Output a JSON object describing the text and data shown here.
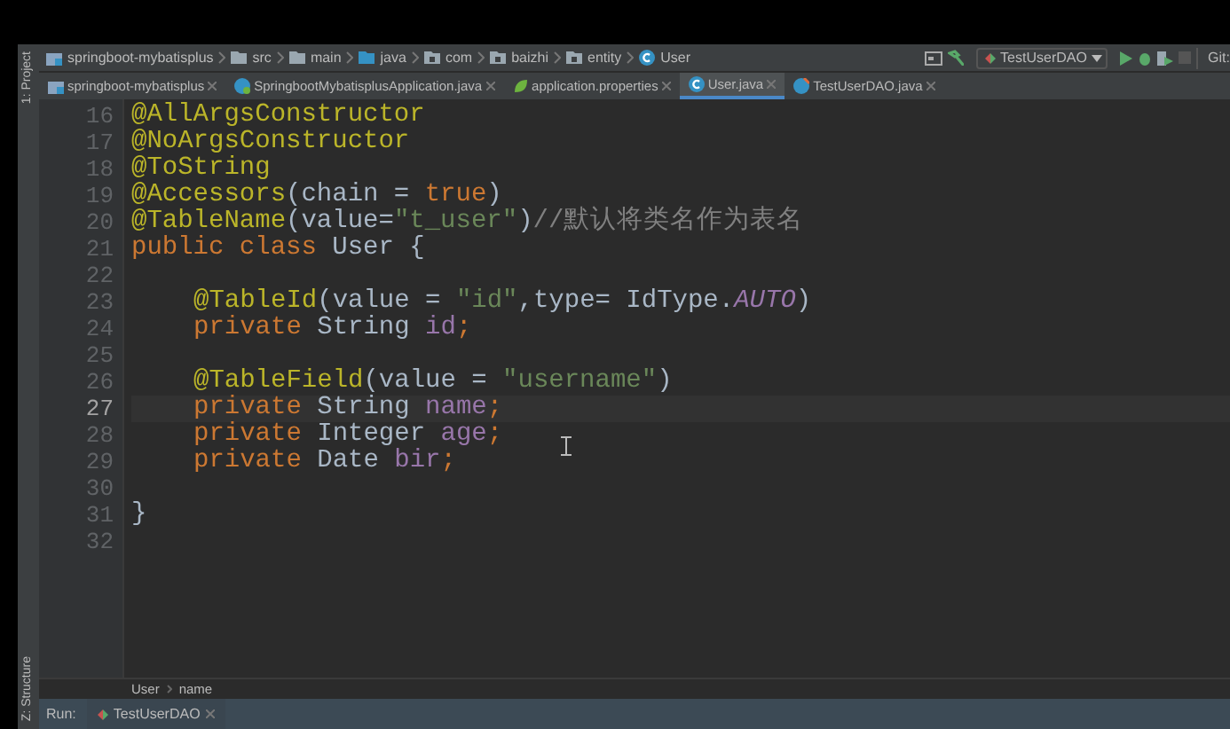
{
  "breadcrumbs": [
    {
      "label": "springboot-mybatisplus",
      "kind": "module"
    },
    {
      "label": "src",
      "kind": "folder"
    },
    {
      "label": "main",
      "kind": "folder"
    },
    {
      "label": "java",
      "kind": "source"
    },
    {
      "label": "com",
      "kind": "package"
    },
    {
      "label": "baizhi",
      "kind": "package"
    },
    {
      "label": "entity",
      "kind": "package"
    },
    {
      "label": "User",
      "kind": "class"
    }
  ],
  "run_config": "TestUserDAO",
  "git_label": "Git:",
  "tabs": [
    {
      "label": "springboot-mybatisplus",
      "kind": "module",
      "selected": false
    },
    {
      "label": "SpringbootMybatisplusApplication.java",
      "kind": "spring",
      "selected": false
    },
    {
      "label": "application.properties",
      "kind": "properties",
      "selected": false
    },
    {
      "label": "User.java",
      "kind": "class",
      "selected": true
    },
    {
      "label": "TestUserDAO.java",
      "kind": "test",
      "selected": false
    }
  ],
  "side_tools": [
    {
      "label": "1: Project"
    },
    {
      "label": "Z: Structure"
    }
  ],
  "editor": {
    "lines": [
      {
        "number": "16",
        "current": false,
        "tokens": [
          {
            "kind": "annotation",
            "text": "@AllArgsConstructor"
          }
        ]
      },
      {
        "number": "17",
        "current": false,
        "tokens": [
          {
            "kind": "annotation",
            "text": "@NoArgsConstructor"
          }
        ]
      },
      {
        "number": "18",
        "current": false,
        "tokens": [
          {
            "kind": "annotation",
            "text": "@ToString"
          }
        ]
      },
      {
        "number": "19",
        "current": false,
        "tokens": [
          {
            "kind": "annotation",
            "text": "@Accessors"
          },
          {
            "kind": "plain",
            "text": "(chain = "
          },
          {
            "kind": "keyword",
            "text": "true"
          },
          {
            "kind": "plain",
            "text": ")"
          }
        ]
      },
      {
        "number": "20",
        "current": false,
        "tokens": [
          {
            "kind": "annotation",
            "text": "@TableName"
          },
          {
            "kind": "plain",
            "text": "(value="
          },
          {
            "kind": "string",
            "text": "\"t_user\""
          },
          {
            "kind": "plain",
            "text": ")"
          },
          {
            "kind": "comment",
            "text": "//默认将类名作为表名"
          }
        ]
      },
      {
        "number": "21",
        "current": false,
        "tokens": [
          {
            "kind": "keyword",
            "text": "public class "
          },
          {
            "kind": "plain",
            "text": "User {"
          }
        ]
      },
      {
        "number": "22",
        "current": false
      },
      {
        "number": "23",
        "current": false,
        "indented": true,
        "tokens": [
          {
            "kind": "annotation",
            "text": "@TableId"
          },
          {
            "kind": "plain",
            "text": "(value = "
          },
          {
            "kind": "string",
            "text": "\"id\""
          },
          {
            "kind": "plain",
            "text": ",type= IdType."
          },
          {
            "kind": "constant",
            "text": "AUTO"
          },
          {
            "kind": "plain",
            "text": ")"
          }
        ]
      },
      {
        "number": "24",
        "current": false,
        "indented": true,
        "tokens": [
          {
            "kind": "keyword",
            "text": "private "
          },
          {
            "kind": "plain",
            "text": "String "
          },
          {
            "kind": "field",
            "text": "id"
          },
          {
            "kind": "keyword",
            "text": ";"
          }
        ]
      },
      {
        "number": "25",
        "current": false
      },
      {
        "number": "26",
        "current": false,
        "indented": true,
        "tokens": [
          {
            "kind": "annotation",
            "text": "@TableField"
          },
          {
            "kind": "plain",
            "text": "(value = "
          },
          {
            "kind": "string",
            "text": "\"username\""
          },
          {
            "kind": "plain",
            "text": ")"
          }
        ]
      },
      {
        "number": "27",
        "current": true,
        "indented": true,
        "tokens": [
          {
            "kind": "keyword",
            "text": "private "
          },
          {
            "kind": "plain",
            "text": "String "
          },
          {
            "kind": "field",
            "text": "name"
          },
          {
            "kind": "keyword",
            "text": ";"
          }
        ]
      },
      {
        "number": "28",
        "current": false,
        "indented": true,
        "tokens": [
          {
            "kind": "keyword",
            "text": "private "
          },
          {
            "kind": "plain",
            "text": "Integer "
          },
          {
            "kind": "field",
            "text": "age"
          },
          {
            "kind": "keyword",
            "text": ";"
          }
        ]
      },
      {
        "number": "29",
        "current": false,
        "indented": true,
        "tokens": [
          {
            "kind": "keyword",
            "text": "private "
          },
          {
            "kind": "plain",
            "text": "Date "
          },
          {
            "kind": "field",
            "text": "bir"
          },
          {
            "kind": "keyword",
            "text": ";"
          }
        ]
      },
      {
        "number": "30",
        "current": false
      },
      {
        "number": "31",
        "current": false,
        "tokens": [
          {
            "kind": "plain",
            "text": "}"
          }
        ]
      },
      {
        "number": "32",
        "current": false
      }
    ]
  },
  "path_bar": [
    "User",
    "name"
  ],
  "run_bar": {
    "label": "Run:",
    "tab": "TestUserDAO"
  }
}
